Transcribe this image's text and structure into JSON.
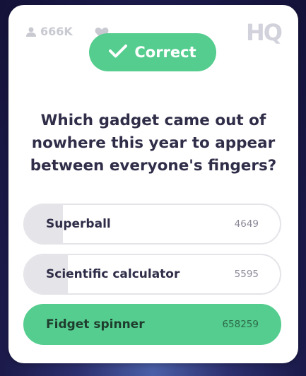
{
  "header": {
    "viewer_count": "666K",
    "logo": "HQ",
    "icons": {
      "viewers": "person-icon",
      "lives": "heart-icon"
    }
  },
  "result": {
    "label": "Correct",
    "icon": "checkmark-icon",
    "color": "#55cd8f"
  },
  "question": {
    "text": "Which gadget came out of nowhere this year to appear between everyone's fingers?"
  },
  "answers": [
    {
      "label": "Superball",
      "count": "4649",
      "share": 0.15,
      "correct": false
    },
    {
      "label": "Scientific calculator",
      "count": "5595",
      "share": 0.17,
      "correct": false
    },
    {
      "label": "Fidget spinner",
      "count": "658259",
      "share": 1.0,
      "correct": true
    }
  ],
  "colors": {
    "correct_green": "#55cd8f",
    "neutral_fill": "#e5e5e9",
    "text_dark": "#2f2d48",
    "muted": "#c9c9d2"
  }
}
